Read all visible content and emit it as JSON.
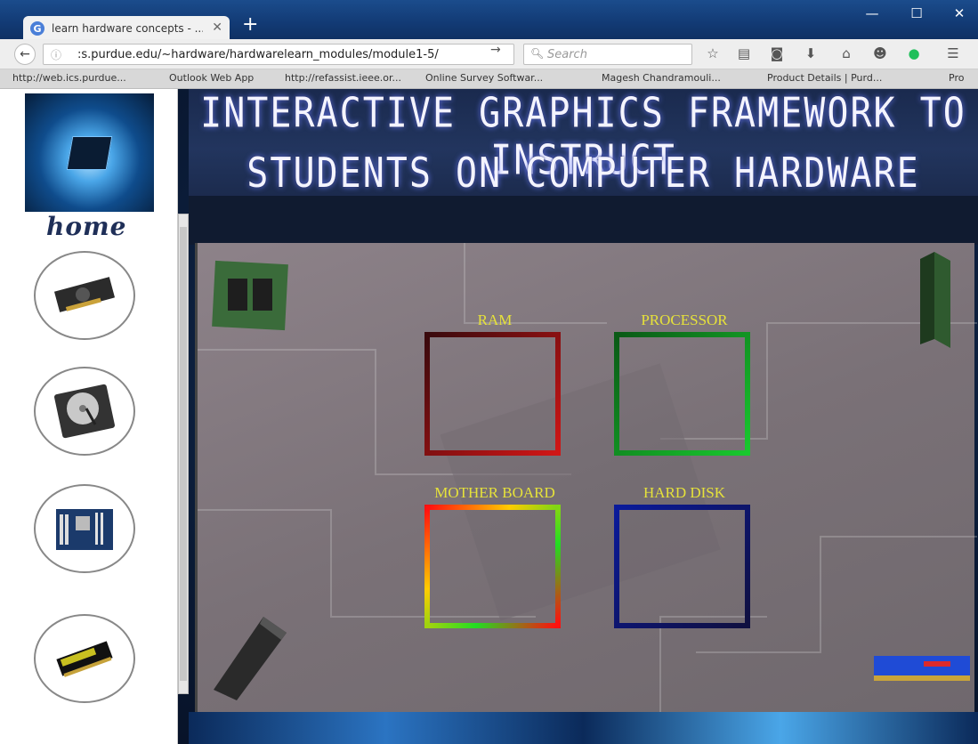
{
  "browser": {
    "tab_title": "learn hardware concepts - ...",
    "tab_close": "✕",
    "new_tab": "+",
    "window": {
      "minimize": "—",
      "maximize": "☐",
      "close": "✕"
    },
    "url": ":s.purdue.edu/~hardware/hardwarelearn_modules/module1-5/",
    "search_placeholder": "Search",
    "bookmarks": [
      "http://web.ics.purdue...",
      "Outlook Web App",
      "http://refassist.ieee.or...",
      "Online Survey Softwar...",
      "Magesh Chandramouli...",
      "Product Details | Purd...",
      "Pro"
    ]
  },
  "sidebar": {
    "home_label": "home",
    "items": [
      "graphics-card",
      "hard-disk",
      "motherboard",
      "ram-module"
    ]
  },
  "header": {
    "line1": "INTERACTIVE GRAPHICS FRAMEWORK TO INSTRUCT",
    "line2": "STUDENTS ON COMPUTER HARDWARE"
  },
  "targets": {
    "ram": "RAM",
    "processor": "PROCESSOR",
    "motherboard": "MOTHER BOARD",
    "harddisk": "HARD DISK"
  },
  "colors": {
    "label_yellow": "#e6e23a",
    "ram": "#d01616",
    "processor": "#19c82e",
    "harddisk": "#0a1a9a"
  }
}
